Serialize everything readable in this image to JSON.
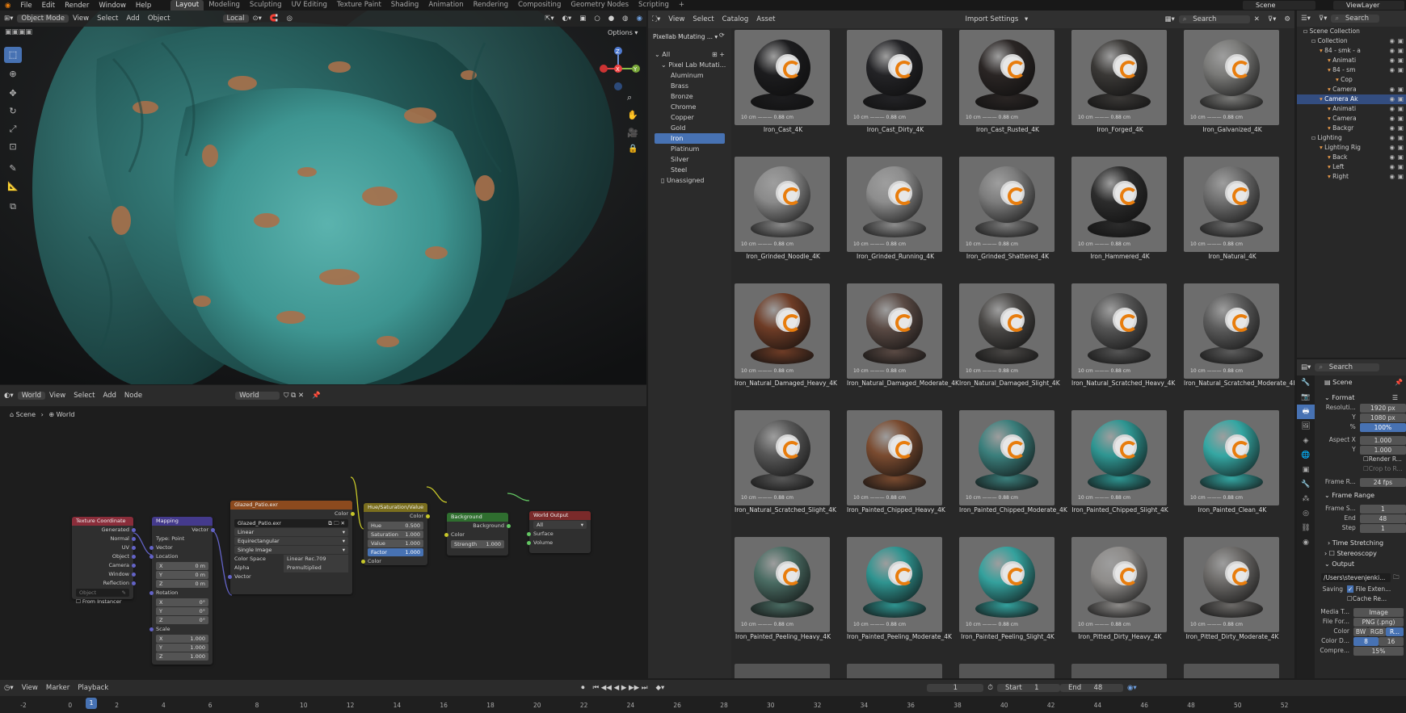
{
  "menubar": {
    "menus": [
      "File",
      "Edit",
      "Render",
      "Window",
      "Help"
    ],
    "workspaces": [
      "Layout",
      "Modeling",
      "Sculpting",
      "UV Editing",
      "Texture Paint",
      "Shading",
      "Animation",
      "Rendering",
      "Compositing",
      "Geometry Nodes",
      "Scripting"
    ],
    "active_workspace": "Layout",
    "scene_label": "Scene",
    "viewlayer_label": "ViewLayer"
  },
  "viewport": {
    "mode": "Object Mode",
    "menus": [
      "View",
      "Select",
      "Add",
      "Object"
    ],
    "transform_orientation": "Local",
    "options_label": "Options",
    "gizmo": {
      "x": "X",
      "y": "Y",
      "z": "Z"
    }
  },
  "node_editor": {
    "world_dropdown": "World",
    "menus": [
      "View",
      "Select",
      "Add",
      "Node"
    ],
    "datablock": "World",
    "breadcrumb": [
      "Scene",
      "World"
    ],
    "nodes": {
      "texcoord": {
        "title": "Texture Coordinate",
        "outputs": [
          "Generated",
          "Normal",
          "UV",
          "Object",
          "Camera",
          "Window",
          "Reflection"
        ],
        "object_placeholder": "Object",
        "instancer": "From Instancer"
      },
      "mapping": {
        "title": "Mapping",
        "out": "Vector",
        "type_label": "Type:",
        "type_value": "Point",
        "vector_in": "Vector",
        "location": "Location",
        "rotation": "Rotation",
        "scale": "Scale",
        "loc": [
          "0 m",
          "0 m",
          "0 m"
        ],
        "rot": [
          "0°",
          "0°",
          "0°"
        ],
        "scl": [
          "1.000",
          "1.000",
          "1.000"
        ],
        "axes": [
          "X",
          "Y",
          "Z"
        ]
      },
      "image": {
        "title": "Glazed_Patio.exr",
        "out": "Color",
        "file": "Glazed_Patio.exr",
        "interp": "Linear",
        "proj": "Equirectangular",
        "src": "Single Image",
        "colorspace_label": "Color Space",
        "colorspace": "Linear Rec.709",
        "alpha_label": "Alpha",
        "alpha": "Premultiplied",
        "vector": "Vector"
      },
      "hsv": {
        "title": "Hue/Saturation/Value",
        "out": "Color",
        "fields": [
          [
            "Hue",
            "0.500"
          ],
          [
            "Saturation",
            "1.000"
          ],
          [
            "Value",
            "1.000"
          ],
          [
            "Factor",
            "1.000"
          ]
        ],
        "color_in": "Color"
      },
      "background": {
        "title": "Background",
        "out": "Background",
        "color": "Color",
        "strength_label": "Strength",
        "strength": "1.000"
      },
      "output": {
        "title": "World Output",
        "target": "All",
        "surface": "Surface",
        "volume": "Volume"
      }
    }
  },
  "asset_browser": {
    "menus": [
      "View",
      "Select",
      "Catalog",
      "Asset"
    ],
    "import_settings": "Import Settings",
    "search_placeholder": "Search",
    "library": "Pixellab Mutating ...",
    "tree_root": "All",
    "tree_group": "Pixel Lab Mutati...",
    "categories": [
      "Aluminum",
      "Brass",
      "Bronze",
      "Chrome",
      "Copper",
      "Gold",
      "Iron",
      "Platinum",
      "Silver",
      "Steel"
    ],
    "active_category": "Iron",
    "unassigned": "Unassigned",
    "scale_text": "10 cm ——— 0.88 cm",
    "assets": [
      {
        "name": "Iron_Cast_4K",
        "tone": "#1c1c1e"
      },
      {
        "name": "Iron_Cast_Dirty_4K",
        "tone": "#232326"
      },
      {
        "name": "Iron_Cast_Rusted_4K",
        "tone": "#2a2524"
      },
      {
        "name": "Iron_Forged_4K",
        "tone": "#3a3836"
      },
      {
        "name": "Iron_Galvanized_4K",
        "tone": "#7a7a78"
      },
      {
        "name": "Iron_Grinded_Noodle_4K",
        "tone": "#8a8a8a"
      },
      {
        "name": "Iron_Grinded_Running_4K",
        "tone": "#8d8d8d"
      },
      {
        "name": "Iron_Grinded_Shattered_4K",
        "tone": "#7d7d7d"
      },
      {
        "name": "Iron_Hammered_4K",
        "tone": "#2c2c2c"
      },
      {
        "name": "Iron_Natural_4K",
        "tone": "#6f6f6f"
      },
      {
        "name": "Iron_Natural_Damaged_Heavy_4K",
        "tone": "#6e3c26"
      },
      {
        "name": "Iron_Natural_Damaged_Moderate_4K",
        "tone": "#5a4a44"
      },
      {
        "name": "Iron_Natural_Damaged_Slight_4K",
        "tone": "#4a4846"
      },
      {
        "name": "Iron_Natural_Scratched_Heavy_4K",
        "tone": "#555555"
      },
      {
        "name": "Iron_Natural_Scratched_Moderate_4K",
        "tone": "#5c5c5c"
      },
      {
        "name": "Iron_Natural_Scratched_Slight_4K",
        "tone": "#585858"
      },
      {
        "name": "Iron_Painted_Chipped_Heavy_4K",
        "tone": "#7a4b30"
      },
      {
        "name": "Iron_Painted_Chipped_Moderate_4K",
        "tone": "#3b7f7c"
      },
      {
        "name": "Iron_Painted_Chipped_Slight_4K",
        "tone": "#2f9692"
      },
      {
        "name": "Iron_Painted_Clean_4K",
        "tone": "#35a7a3"
      },
      {
        "name": "Iron_Painted_Peeling_Heavy_4K",
        "tone": "#4a6c63"
      },
      {
        "name": "Iron_Painted_Peeling_Moderate_4K",
        "tone": "#2f9490"
      },
      {
        "name": "Iron_Painted_Peeling_Slight_4K",
        "tone": "#34a19d"
      },
      {
        "name": "Iron_Pitted_Dirty_Heavy_4K",
        "tone": "#8e8c8a"
      },
      {
        "name": "Iron_Pitted_Dirty_Moderate_4K",
        "tone": "#6c6a68"
      }
    ]
  },
  "outliner": {
    "search_placeholder": "Search",
    "items": [
      {
        "label": "Scene Collection",
        "depth": 0
      },
      {
        "label": "Collection",
        "depth": 1
      },
      {
        "label": "84 - smk - a",
        "depth": 2
      },
      {
        "label": "Animati",
        "depth": 3
      },
      {
        "label": "84 - sm",
        "depth": 3
      },
      {
        "label": "Cop",
        "depth": 4
      },
      {
        "label": "Camera",
        "depth": 3
      },
      {
        "label": "Camera Ak",
        "depth": 2,
        "active": true
      },
      {
        "label": "Animati",
        "depth": 3
      },
      {
        "label": "Camera",
        "depth": 3
      },
      {
        "label": "Backgr",
        "depth": 3
      },
      {
        "label": "Lighting",
        "depth": 1
      },
      {
        "label": "Lighting Rig",
        "depth": 2
      },
      {
        "label": "Back",
        "depth": 3
      },
      {
        "label": "Left",
        "depth": 3
      },
      {
        "label": "Right",
        "depth": 3
      }
    ]
  },
  "properties": {
    "search_placeholder": "Search",
    "context": "Scene",
    "format_title": "Format",
    "resolution_x_label": "Resoluti...",
    "resolution_x": "1920 px",
    "resolution_y_label": "Y",
    "resolution_y": "1080 px",
    "percent_label": "%",
    "percent": "100%",
    "aspect_x_label": "Aspect X",
    "aspect_x": "1.000",
    "aspect_y_label": "Y",
    "aspect_y": "1.000",
    "render_region": "Render R...",
    "crop": "Crop to R...",
    "frame_rate_label": "Frame R...",
    "frame_rate": "24 fps",
    "frame_range_title": "Frame Range",
    "frame_start_label": "Frame S...",
    "frame_start": "1",
    "end_label": "End",
    "end": "48",
    "step_label": "Step",
    "step": "1",
    "time_stretching": "Time Stretching",
    "stereoscopy": "Stereoscopy",
    "output_title": "Output",
    "output_path": "/Users\\stevenjenki...",
    "saving_label": "Saving",
    "file_ext": "File Exten...",
    "cache": "Cache Re...",
    "media_label": "Media T...",
    "media": "Image",
    "format_label": "File For...",
    "file_format": "PNG (.png)",
    "color_label": "Color",
    "color_modes": [
      "BW",
      "RGB",
      "R..."
    ],
    "depth_label": "Color D...",
    "depth_values": [
      "8",
      "16"
    ],
    "compress_label": "Compre...",
    "compress": "15%"
  },
  "timeline": {
    "menus": [
      "View",
      "Marker",
      "Playback"
    ],
    "current_frame": "1",
    "start_label": "Start",
    "start": "1",
    "end_label": "End",
    "end": "48",
    "ticks": [
      "-2",
      "0",
      "2",
      "4",
      "6",
      "8",
      "10",
      "12",
      "14",
      "16",
      "18",
      "20",
      "22",
      "24",
      "26",
      "28",
      "30",
      "32",
      "34",
      "36",
      "38",
      "40",
      "42",
      "44",
      "46",
      "48",
      "50",
      "52"
    ],
    "playhead": "1"
  },
  "colors": {
    "accent": "#4772b3",
    "panel": "#303030",
    "editor": "#282828",
    "teal": "#2fa3a0",
    "copper": "#b06f42"
  }
}
